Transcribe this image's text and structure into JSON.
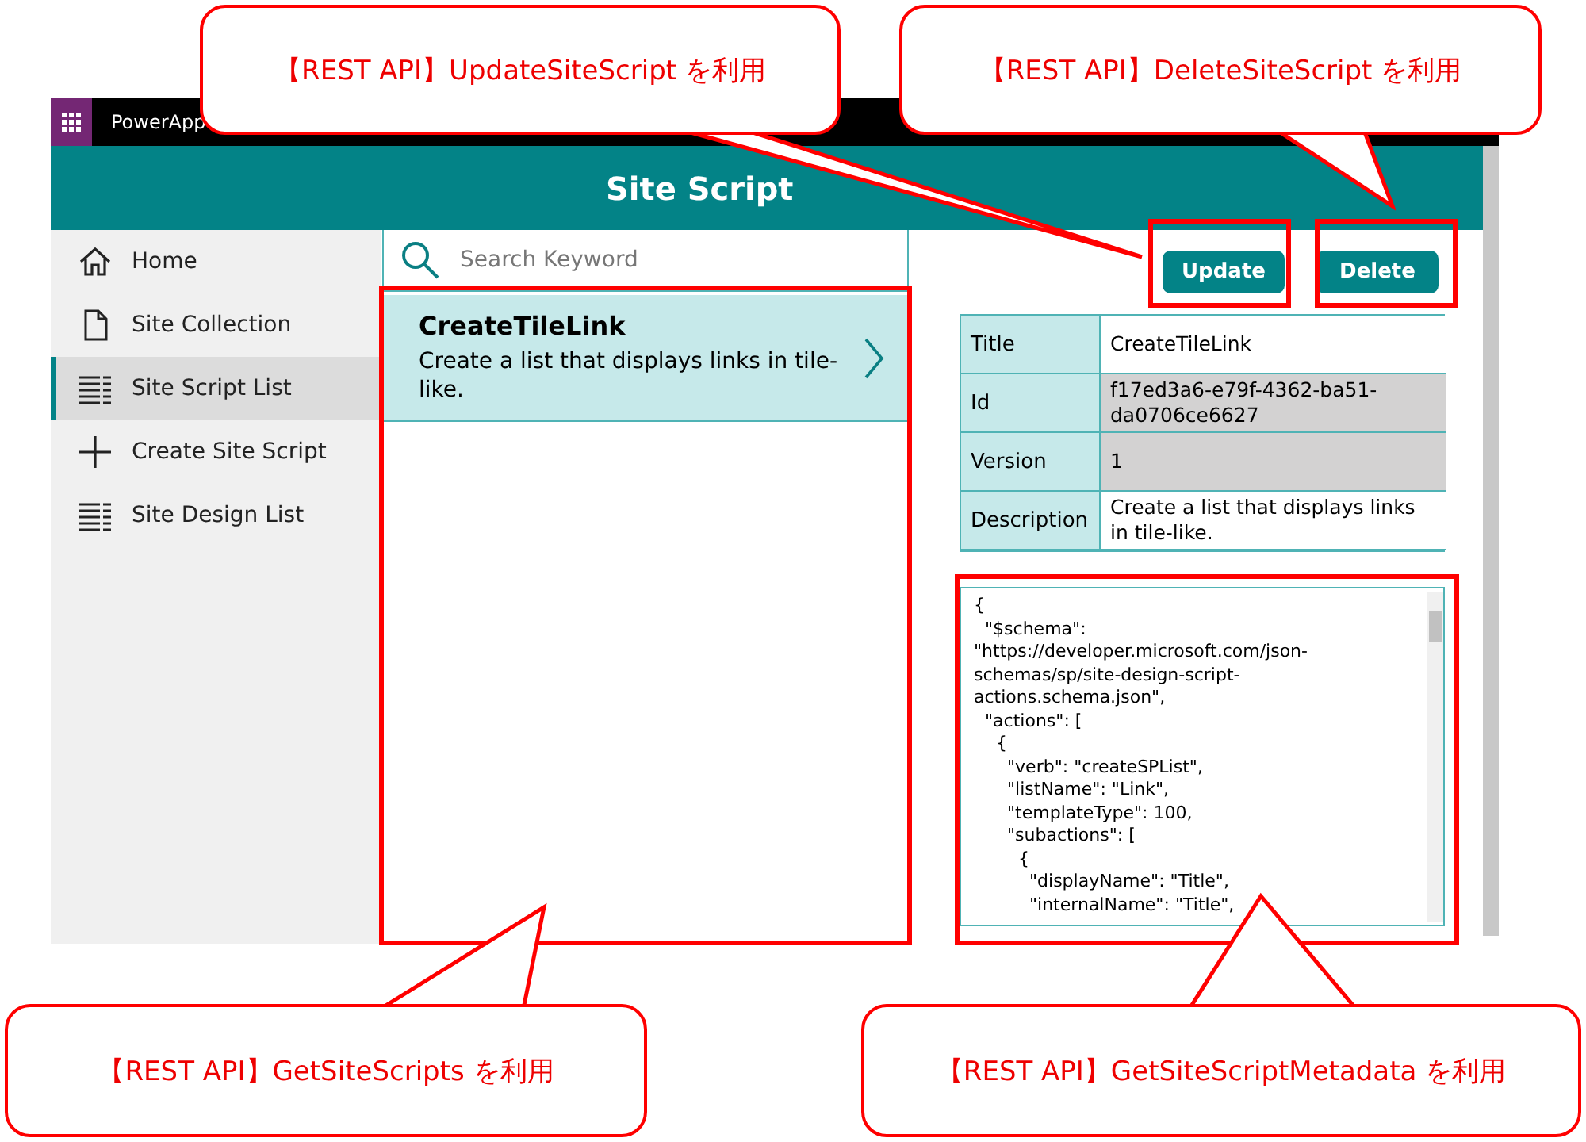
{
  "app_bar": {
    "title": "PowerApp"
  },
  "header": {
    "title": "Site Script"
  },
  "sidebar": {
    "items": [
      {
        "label": "Home",
        "selected": false
      },
      {
        "label": "Site Collection",
        "selected": false
      },
      {
        "label": "Site Script List",
        "selected": true
      },
      {
        "label": "Create Site Script",
        "selected": false
      },
      {
        "label": "Site Design List",
        "selected": false
      }
    ]
  },
  "search": {
    "placeholder": "Search Keyword"
  },
  "scripts": [
    {
      "title": "CreateTileLink",
      "description": "Create a list that displays links in tile-like.",
      "selected": true
    }
  ],
  "buttons": [
    "Update",
    "Delete"
  ],
  "details": [
    {
      "label": "Title",
      "value": "CreateTileLink",
      "readonly": false
    },
    {
      "label": "Id",
      "value": "f17ed3a6-e79f-4362-ba51-da0706ce6627",
      "readonly": true
    },
    {
      "label": "Version",
      "value": "1",
      "readonly": true
    },
    {
      "label": "Description",
      "value": "Create a list that displays links in tile-like.",
      "readonly": false
    }
  ],
  "script_content": "{\n  \"$schema\": \"https://developer.microsoft.com/json-schemas/sp/site-design-script-actions.schema.json\",\n  \"actions\": [\n    {\n      \"verb\": \"createSPList\",\n      \"listName\": \"Link\",\n      \"templateType\": 100,\n      \"subactions\": [\n        {\n          \"displayName\": \"Title\",\n          \"internalName\": \"Title\",",
  "callouts": [
    {
      "text": "【REST API】UpdateSiteScript を利用"
    },
    {
      "text": "【REST API】DeleteSiteScript を利用"
    },
    {
      "text": "【REST API】GetSiteScripts を利用"
    },
    {
      "text": "【REST API】GetSiteScriptMetadata を利用"
    }
  ]
}
